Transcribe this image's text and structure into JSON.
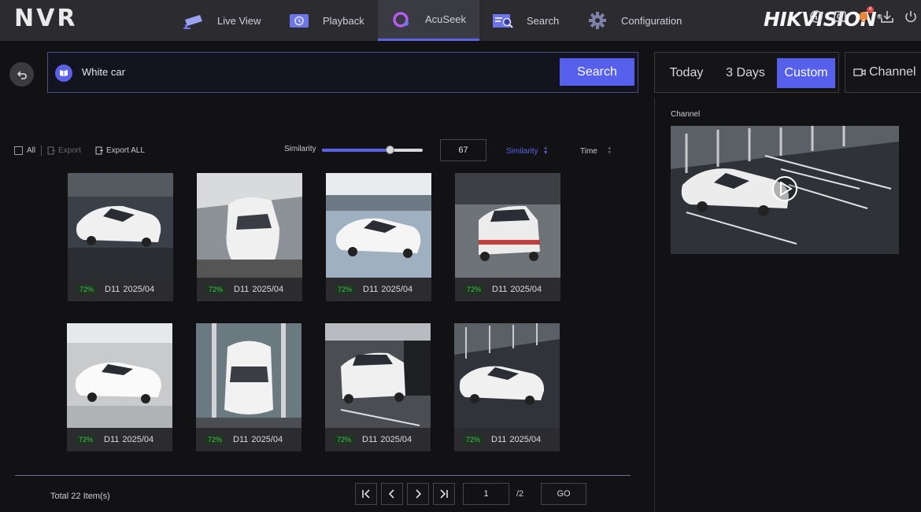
{
  "app": {
    "logo": "NVR",
    "brand": "HIKVISION",
    "brand_mark": "®"
  },
  "nav": [
    {
      "label": "Live View",
      "icon": "camera-icon"
    },
    {
      "label": "Playback",
      "icon": "playback-icon"
    },
    {
      "label": "AcuSeek",
      "icon": "acuseek-icon",
      "active": true
    },
    {
      "label": "Search",
      "icon": "search-list-icon"
    },
    {
      "label": "Configuration",
      "icon": "gear-icon"
    }
  ],
  "top_icons": [
    "info-icon",
    "settings-icon",
    "notification-bell-icon",
    "download-icon",
    "power-icon"
  ],
  "notification_count": "4",
  "search": {
    "query": "White car",
    "button": "Search"
  },
  "date_filter": {
    "options": [
      "Today",
      "3 Days",
      "Custom"
    ],
    "selected": "Custom"
  },
  "channel_button": "Channel",
  "toolbar": {
    "all_label": "All",
    "export_label": "Export",
    "export_all_label": "Export ALL",
    "similarity_label": "Similarity",
    "similarity_value": "67",
    "similarity_level": 0.67,
    "sort_similarity": "Similarity",
    "sort_time": "Time"
  },
  "results": [
    {
      "score": "72%",
      "channel": "D11",
      "date": "2025/04"
    },
    {
      "score": "72%",
      "channel": "D11",
      "date": "2025/04"
    },
    {
      "score": "72%",
      "channel": "D11",
      "date": "2025/04"
    },
    {
      "score": "72%",
      "channel": "D11",
      "date": "2025/04"
    },
    {
      "score": "72%",
      "channel": "D11",
      "date": "2025/04"
    },
    {
      "score": "72%",
      "channel": "D11",
      "date": "2025/04"
    },
    {
      "score": "72%",
      "channel": "D11",
      "date": "2025/04"
    },
    {
      "score": "72%",
      "channel": "D11",
      "date": "2025/04"
    }
  ],
  "preview": {
    "label": "Channel"
  },
  "pagination": {
    "total": "Total 22 Item(s)",
    "page": "1",
    "of": "/2",
    "go": "GO"
  },
  "colors": {
    "accent": "#5660ec",
    "score_green": "#4aba5c",
    "topbar": "#2b2b30",
    "background": "#121214"
  }
}
